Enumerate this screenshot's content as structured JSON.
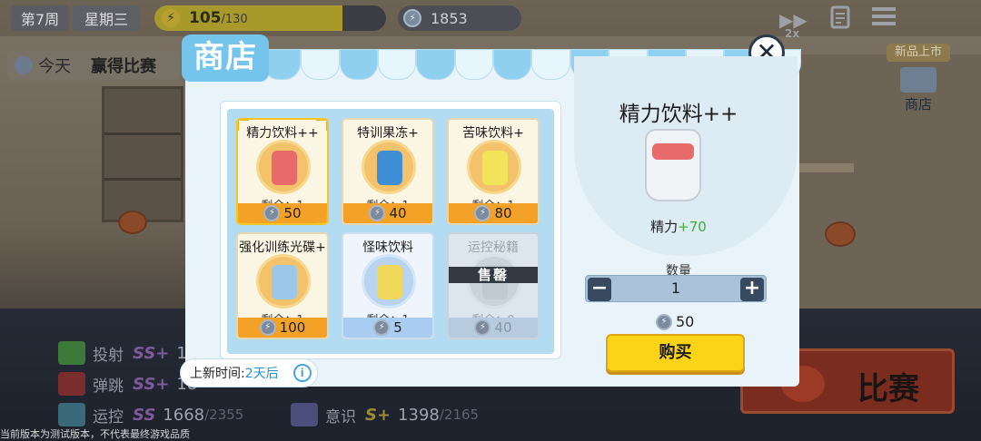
{
  "hud": {
    "week": "第7周",
    "day": "星期三",
    "energy_value": "105",
    "energy_max": "/130",
    "energy_fraction": 0.81,
    "coins": "1853",
    "speed_icon": "double-forward-icon",
    "speed_label": "2x",
    "task_icon": "clipboard-icon",
    "menu_icon": "hamburger-menu-icon"
  },
  "today": {
    "label": "今天",
    "goal": "赢得比赛"
  },
  "new_arrivals": {
    "tag": "新品上市",
    "label": "商店"
  },
  "stats": [
    {
      "name": "投射",
      "grade": "SS+",
      "value": "19",
      "max": ""
    },
    {
      "name": "弹跳",
      "grade": "SS+",
      "value": "18",
      "max": ""
    },
    {
      "name": "运控",
      "grade": "SS",
      "value": "1668",
      "max": "/2355"
    },
    {
      "name": "意识",
      "grade": "S+",
      "value": "1398",
      "max": "/2165"
    }
  ],
  "match_button": "比赛",
  "footer_note": "当前版本为测试版本，不代表最终游戏品质",
  "shop": {
    "title": "商店",
    "close_icon": "close-icon",
    "items": [
      {
        "name": "精力饮料++",
        "remaining": "剩余：1",
        "price": "50",
        "tone": "gold",
        "selected": true,
        "sold": false,
        "color": "#e86a6a"
      },
      {
        "name": "特训果冻+",
        "remaining": "剩余：1",
        "price": "40",
        "tone": "gold",
        "selected": false,
        "sold": false,
        "color": "#3f8fd6"
      },
      {
        "name": "苦味饮料+",
        "remaining": "剩余：1",
        "price": "80",
        "tone": "gold",
        "selected": false,
        "sold": false,
        "color": "#f2e35a"
      },
      {
        "name": "强化训练光碟+",
        "remaining": "剩余：1",
        "price": "100",
        "tone": "gold",
        "selected": false,
        "sold": false,
        "color": "#9cc7e8"
      },
      {
        "name": "怪味饮料",
        "remaining": "剩余：1",
        "price": "5",
        "tone": "blue",
        "selected": false,
        "sold": false,
        "color": "#f0d85a"
      },
      {
        "name": "运控秘籍",
        "remaining": "剩余：0",
        "price": "40",
        "tone": "blue",
        "selected": false,
        "sold": true,
        "sold_label": "售罄",
        "color": "#c0c8d0"
      }
    ],
    "restock_label": "上新时间:",
    "restock_time": "2天后",
    "info_icon": "info-icon",
    "detail": {
      "name": "精力饮料++",
      "effect_stat": "精力",
      "effect_value": "+70",
      "quantity_label": "数量",
      "quantity": "1",
      "minus": "−",
      "plus": "+",
      "total": "50",
      "buy_label": "购买"
    }
  }
}
